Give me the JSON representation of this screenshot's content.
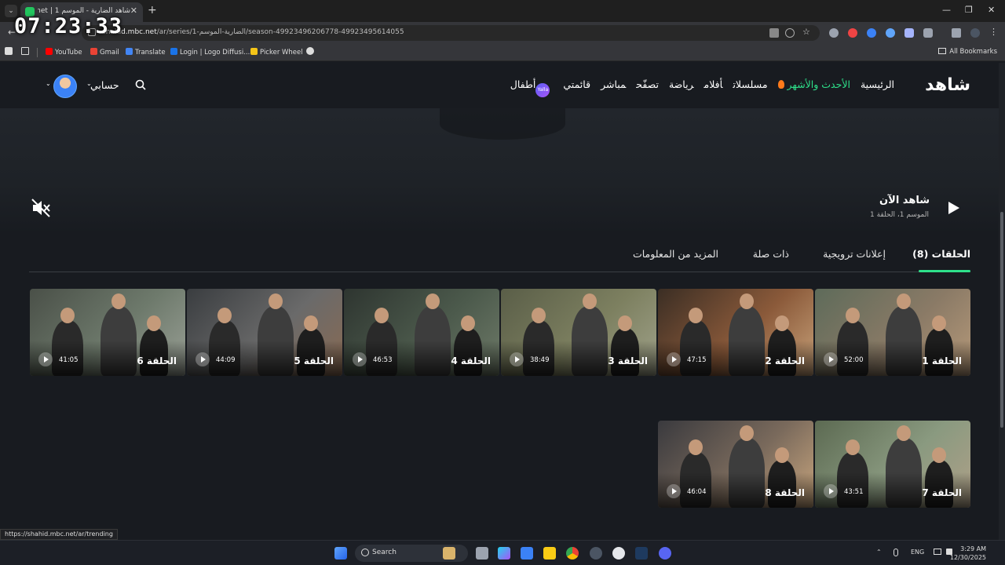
{
  "browser": {
    "tab_title": "شاهد الضارية - الموسم 1 | Shahid.net",
    "close_glyph": "✕",
    "new_tab_glyph": "+",
    "url_host": "shahid.mbc.net",
    "url_path": "/ar/series/الضارية-الموسم-1/season-49923496206778-49923495614055",
    "back_glyph": "←",
    "window_controls": [
      "—",
      "❐",
      "✕"
    ],
    "bookmarks": [
      {
        "label": "YouTube",
        "color": "#ff0000"
      },
      {
        "label": "Gmail",
        "color": "#ea4335"
      },
      {
        "label": "Translate",
        "color": "#4285f4"
      },
      {
        "label": "Login | Logo Diffusi...",
        "color": "#1a73e8"
      },
      {
        "label": "Picker Wheel",
        "color": "#f5c518"
      }
    ],
    "all_bookmarks": "All Bookmarks",
    "status_url": "https://shahid.mbc.net/ar/trending"
  },
  "overlay_clock": "07:23:33",
  "header": {
    "logo": "شاهد",
    "nav": [
      "الرئيسية",
      "الأحدث والأشهر",
      "مسلسلات",
      "أفلام",
      "رياضة",
      "تصفّح",
      "مباشر",
      "قائمتي",
      "أطفال"
    ],
    "active_nav": "الأحدث والأشهر",
    "kids_badge": "Yalla",
    "account_label": "حسابي",
    "chevron": "⌄"
  },
  "hero": {
    "watch_now": "شاهد الآن",
    "subtitle": "الموسم 1، الحلقة 1"
  },
  "tabs": [
    {
      "label": "الحلقات (8)",
      "active": true
    },
    {
      "label": "إعلانات ترويجية",
      "active": false
    },
    {
      "label": "ذات صلة",
      "active": false
    },
    {
      "label": "المزيد من المعلومات",
      "active": false
    }
  ],
  "episodes": [
    {
      "label": "الحلقة 1",
      "duration": "52:00",
      "palette": [
        "#5e6b5a",
        "#8a7a66",
        "#b79a7a"
      ]
    },
    {
      "label": "الحلقة 2",
      "duration": "47:15",
      "palette": [
        "#3b2e24",
        "#8b5a3a",
        "#c8a27a"
      ]
    },
    {
      "label": "الحلقة 3",
      "duration": "38:49",
      "palette": [
        "#5a5e48",
        "#7d8060",
        "#a0a28a"
      ]
    },
    {
      "label": "الحلقة 4",
      "duration": "46:53",
      "palette": [
        "#2e3530",
        "#4c5a4c",
        "#6e7a68"
      ]
    },
    {
      "label": "الحلقة 5",
      "duration": "44:09",
      "palette": [
        "#3a3d40",
        "#6a6a6a",
        "#8a6a52"
      ]
    },
    {
      "label": "الحلقة 6",
      "duration": "41:05",
      "palette": [
        "#4a5048",
        "#6e7a6c",
        "#9aa096"
      ]
    },
    {
      "label": "الحلقة 7",
      "duration": "43:51",
      "palette": [
        "#5c6a52",
        "#8a9a80",
        "#b0a088"
      ]
    },
    {
      "label": "الحلقة 8",
      "duration": "46:04",
      "palette": [
        "#3a3a3e",
        "#7a6a5c",
        "#c9a67e"
      ]
    }
  ],
  "taskbar": {
    "search_label": "Search",
    "lang": "ENG",
    "time": "3:29 AM",
    "date": "12/30/2025"
  },
  "colors": {
    "accent": "#2ee08a",
    "background": "#181b20"
  }
}
